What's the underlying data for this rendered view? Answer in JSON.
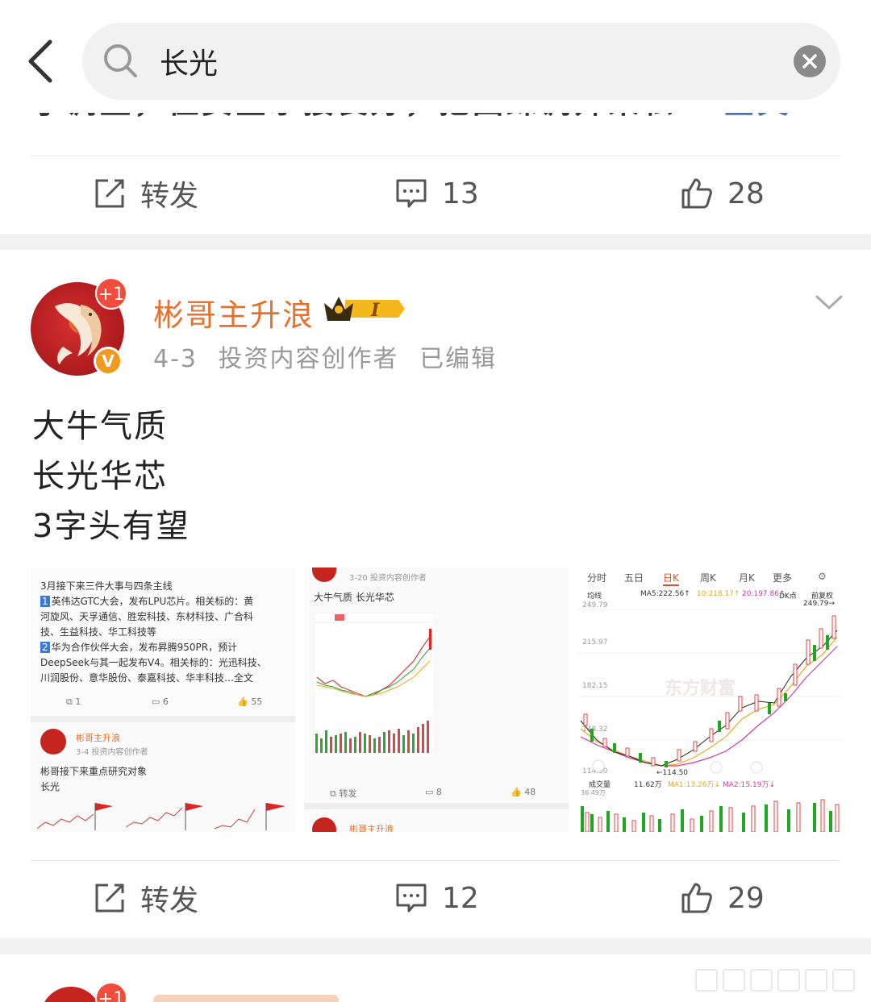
{
  "search": {
    "query": "长光"
  },
  "previous_post": {
    "truncated_text": "了调整，但资金承接良好，把回踩调开采私…",
    "more_label": "全文",
    "actions": {
      "repost": "转发",
      "comments": "13",
      "likes": "28"
    }
  },
  "post": {
    "author": "彬哥主升浪",
    "avatar_badge": "+1",
    "verified_badge": "V",
    "vip_level": "I",
    "date": "4-3",
    "role": "投资内容创作者",
    "edited": "已编辑",
    "lines": [
      "大牛气质",
      "长光华芯",
      "3字头有望"
    ],
    "images": [
      {
        "header": "3月接下来三件大事与四条主线",
        "lines": [
          "英伟达GTC大会，发布LPU芯片。相关标的：黄",
          "河旋风、天孚通信、胜宏科技、东材科技、广合科",
          "技、生益科技、华工科技等",
          "华为合作伙伴大会，发布昇腾950PR，预计",
          "DeepSeek与其一起发布V4。相关标的：光迅科技、",
          "川润股份、意华股份、泰嘉科技、华丰科技…全文"
        ],
        "stats": [
          "1",
          "6",
          "55"
        ],
        "sub_author": "彬哥主升浪",
        "sub_meta": "3-4  投资内容创作者",
        "sub_text": "彬哥接下来重点研究对象",
        "sub_text2": "长光"
      },
      {
        "meta": "3-20  投资内容创作者",
        "title": "大牛气质  长光华芯",
        "stats": [
          "转发",
          "8",
          "48"
        ],
        "sub_author": "彬哥主升浪"
      },
      {
        "tabs": [
          "分时",
          "五日",
          "日K",
          "周K",
          "月K",
          "更多",
          "⚙"
        ],
        "ma_row": [
          "均线",
          "MA5:222.56↑",
          "10:218.17↑",
          "20:197.86↑",
          "DK点",
          "前复权"
        ],
        "prices": [
          "249.79",
          "215.97",
          "182.15",
          "148.32",
          "114.50"
        ],
        "high_label": "249.79→",
        "low_label": "←114.50",
        "vol_row": [
          "成交量",
          "11.62万",
          "MA1:13.26万↓",
          "MA2:15.19万↓"
        ],
        "vol_max": "36.49万",
        "watermark": "东方财富"
      }
    ],
    "actions": {
      "repost": "转发",
      "comments": "12",
      "likes": "29"
    }
  },
  "next_post": {
    "avatar_badge": "+1"
  }
}
